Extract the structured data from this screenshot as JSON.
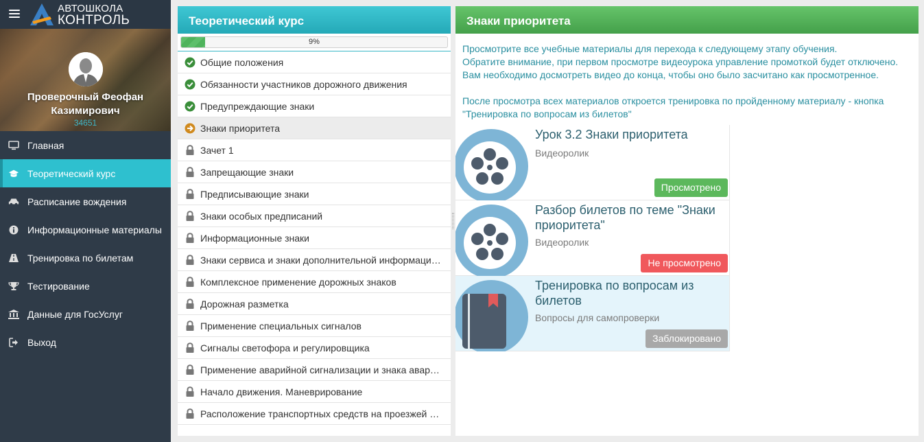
{
  "app": {
    "logo_line1": "АВТОШКОЛА",
    "logo_line2": "КОНТРОЛЬ"
  },
  "user": {
    "name": "Проверочный Феофан Казимирович",
    "id": "34651"
  },
  "nav": {
    "items": [
      {
        "label": "Главная",
        "icon": "monitor-icon"
      },
      {
        "label": "Теоретический курс",
        "icon": "graduation-cap-icon"
      },
      {
        "label": "Расписание вождения",
        "icon": "car-icon"
      },
      {
        "label": "Информационные материалы",
        "icon": "info-icon"
      },
      {
        "label": "Тренировка по билетам",
        "icon": "road-icon"
      },
      {
        "label": "Тестирование",
        "icon": "trophy-icon"
      },
      {
        "label": "Данные для ГосУслуг",
        "icon": "bank-icon"
      },
      {
        "label": "Выход",
        "icon": "sign-out-icon"
      }
    ],
    "active_index": 1
  },
  "course": {
    "title": "Теоретический курс",
    "progress_text": "9%",
    "progress_value": 0.09,
    "lessons": [
      {
        "label": "Общие положения",
        "status": "done"
      },
      {
        "label": "Обязанности участников дорожного движения",
        "status": "done"
      },
      {
        "label": "Предупреждающие знаки",
        "status": "done"
      },
      {
        "label": "Знаки приоритета",
        "status": "current"
      },
      {
        "label": "Зачет 1",
        "status": "locked"
      },
      {
        "label": "Запрещающие знаки",
        "status": "locked"
      },
      {
        "label": "Предписывающие знаки",
        "status": "locked"
      },
      {
        "label": "Знаки особых предписаний",
        "status": "locked"
      },
      {
        "label": "Информационные знаки",
        "status": "locked"
      },
      {
        "label": "Знаки сервиса и знаки дополнительной информаци…",
        "status": "locked"
      },
      {
        "label": "Комплексное применение дорожных знаков",
        "status": "locked"
      },
      {
        "label": "Дорожная разметка",
        "status": "locked"
      },
      {
        "label": "Применение специальных сигналов",
        "status": "locked"
      },
      {
        "label": "Сигналы светофора и регулировщика",
        "status": "locked"
      },
      {
        "label": "Применение аварийной сигнализации и знака авар…",
        "status": "locked"
      },
      {
        "label": "Начало движения. Маневрирование",
        "status": "locked"
      },
      {
        "label": "Расположение транспортных средств на проезжей …",
        "status": "locked"
      }
    ]
  },
  "topic": {
    "title": "Знаки приоритета",
    "info_line1": "Просмотрите все учебные материалы для перехода к следующему этапу обучения.",
    "info_line2": "Обратите внимание, при первом просмотре видеоурока управление промоткой будет отключено.",
    "info_line3": "Вам необходимо досмотреть видео до конца, чтобы оно было засчитано как просмотренное.",
    "info_line4": "После просмотра всех материалов откроется тренировка по пройденному материалу - кнопка",
    "info_line5": "\"Тренировка по вопросам из билетов\"",
    "materials": [
      {
        "title": "Урок 3.2 Знаки приоритета",
        "type": "Видеоролик",
        "status": "Просмотрено",
        "status_color": "#5cb85c",
        "icon": "film-reel-icon"
      },
      {
        "title": "Разбор билетов по теме \"Знаки приоритета\"",
        "type": "Видеоролик",
        "status": "Не просмотрено",
        "status_color": "#f0585c",
        "icon": "film-reel-icon"
      },
      {
        "title": "Тренировка по вопросам из билетов",
        "type": "Вопросы для самопроверки",
        "status": "Заблокировано",
        "status_color": "#a8a8a8",
        "icon": "book-icon"
      }
    ]
  }
}
